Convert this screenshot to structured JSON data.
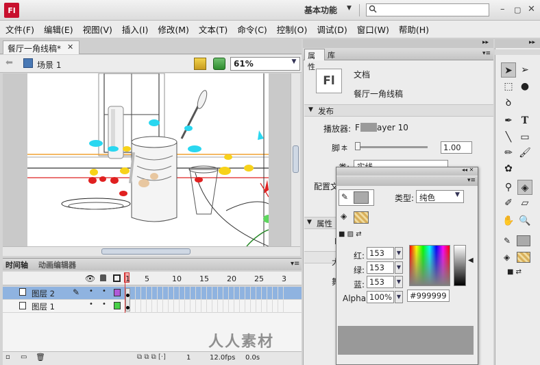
{
  "top_bar": {
    "logo": "Fl",
    "workspace": "基本功能",
    "search_placeholder": ""
  },
  "menu": [
    "文件(F)",
    "编辑(E)",
    "视图(V)",
    "插入(I)",
    "修改(M)",
    "文本(T)",
    "命令(C)",
    "控制(O)",
    "调试(D)",
    "窗口(W)",
    "帮助(H)"
  ],
  "document": {
    "tab_label": "餐厅一角线稿*",
    "scene_label": "场景 1",
    "zoom": "61%"
  },
  "timeline": {
    "tab_timeline": "时间轴",
    "tab_motion": "动画编辑器",
    "ruler": [
      "1",
      "5",
      "10",
      "15",
      "20",
      "25",
      "3"
    ],
    "layers": [
      {
        "name": "图层 2",
        "selected": true,
        "color": "#b05ad8"
      },
      {
        "name": "图层 1",
        "selected": false,
        "color": "#48d048"
      }
    ],
    "status": {
      "fps": "12.0fps",
      "time": "0.0s",
      "frame": "1"
    }
  },
  "properties": {
    "tab_active": "属性",
    "tab_library": "库",
    "doc_icon": "Fl",
    "doc_type": "文档",
    "doc_name": "餐厅一角线稿",
    "publish_section": "发布",
    "player_label": "播放器:",
    "player_value_prefix": "F",
    "player_value_suffix": "ayer 10",
    "script_label": "脚",
    "script_label2": "本",
    "script_value": "1.00",
    "class_label": "类:",
    "class_value": "实线",
    "profile_label": "配置文件:",
    "profile_value": "默",
    "props_section": "属性",
    "props_sub_f": "F",
    "size_label": "大",
    "stage_label": "舞"
  },
  "color_panel": {
    "type_label": "类型:",
    "type_value": "纯色",
    "red_label": "红:",
    "red": "153",
    "green_label": "绿:",
    "green": "153",
    "blue_label": "蓝:",
    "blue": "153",
    "alpha_label": "Alpha:",
    "alpha": "100%",
    "hex": "#999999",
    "fill_color": "#999999"
  },
  "watermark": "人人素材"
}
